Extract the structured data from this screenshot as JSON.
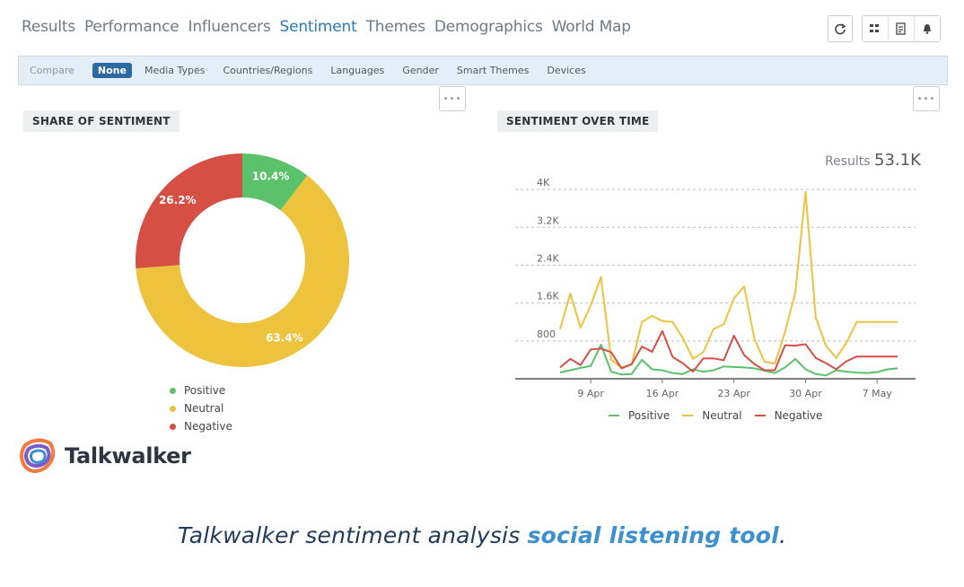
{
  "nav": {
    "tabs": [
      {
        "label": "Results",
        "active": false
      },
      {
        "label": "Performance",
        "active": false
      },
      {
        "label": "Influencers",
        "active": false
      },
      {
        "label": "Sentiment",
        "active": true
      },
      {
        "label": "Themes",
        "active": false
      },
      {
        "label": "Demographics",
        "active": false
      },
      {
        "label": "World Map",
        "active": false
      }
    ],
    "actions": [
      "refresh-icon",
      "grid-add-icon",
      "export-icon",
      "alert-icon"
    ]
  },
  "compare_bar": {
    "label": "Compare",
    "items": [
      {
        "label": "None",
        "active": true
      },
      {
        "label": "Media Types",
        "active": false
      },
      {
        "label": "Countries/Regions",
        "active": false
      },
      {
        "label": "Languages",
        "active": false
      },
      {
        "label": "Gender",
        "active": false
      },
      {
        "label": "Smart Themes",
        "active": false
      },
      {
        "label": "Devices",
        "active": false
      }
    ]
  },
  "colors": {
    "positive": "#5bc26b",
    "neutral": "#edc23d",
    "negative": "#d54f45",
    "accent": "#2b7ab4"
  },
  "panels": {
    "share": {
      "title": "SHARE OF SENTIMENT",
      "more_icon": "more-icon"
    },
    "over_time": {
      "title": "SENTIMENT OVER TIME",
      "more_icon": "more-icon",
      "results_label": "Results",
      "results_value": "53.1K"
    }
  },
  "chart_data": [
    {
      "type": "pie",
      "title": "SHARE OF SENTIMENT",
      "categories": [
        "Positive",
        "Neutral",
        "Negative"
      ],
      "values": [
        10.4,
        63.4,
        26.2
      ],
      "labels": [
        "10.4%",
        "63.4%",
        "26.2%"
      ],
      "style": "donut",
      "legend": "bottom"
    },
    {
      "type": "line",
      "title": "SENTIMENT OVER TIME",
      "ylim": [
        0,
        4400
      ],
      "yticks": [
        800,
        1600,
        2400,
        3200,
        4000
      ],
      "ytick_labels": [
        "800",
        "1.6K",
        "2.4K",
        "3.2K",
        "4K"
      ],
      "xticks": [
        3,
        10,
        17,
        24,
        31
      ],
      "xtick_labels": [
        "9 Apr",
        "16 Apr",
        "23 Apr",
        "30 Apr",
        "7 May"
      ],
      "x": [
        0,
        1,
        2,
        3,
        4,
        5,
        6,
        7,
        8,
        9,
        10,
        11,
        12,
        13,
        14,
        15,
        16,
        17,
        18,
        19,
        20,
        21,
        22,
        23,
        24,
        25,
        26,
        27,
        28,
        29,
        30,
        31,
        32,
        33
      ],
      "series": [
        {
          "name": "Positive",
          "values": [
            130,
            180,
            230,
            270,
            720,
            150,
            90,
            100,
            400,
            200,
            180,
            120,
            100,
            200,
            150,
            180,
            260,
            250,
            240,
            220,
            170,
            120,
            240,
            420,
            200,
            100,
            70,
            180,
            150,
            130,
            120,
            140,
            200,
            220
          ]
        },
        {
          "name": "Neutral",
          "values": [
            1050,
            1800,
            1080,
            1550,
            2150,
            400,
            240,
            300,
            1200,
            1330,
            1220,
            1200,
            860,
            420,
            560,
            1050,
            1150,
            1700,
            1950,
            840,
            360,
            320,
            990,
            1820,
            3950,
            1290,
            700,
            440,
            760,
            1200,
            1200,
            1200,
            1200,
            1200
          ]
        },
        {
          "name": "Negative",
          "values": [
            240,
            420,
            290,
            620,
            640,
            560,
            220,
            310,
            680,
            570,
            1010,
            460,
            330,
            150,
            430,
            430,
            390,
            910,
            500,
            310,
            180,
            180,
            710,
            700,
            730,
            440,
            330,
            200,
            370,
            470,
            470,
            470,
            470,
            470
          ]
        }
      ],
      "legend": "bottom",
      "grid": true
    }
  ],
  "logo": {
    "text": "Talkwalker"
  },
  "caption": {
    "prefix": "Talkwalker sentiment analysis ",
    "highlight": "social listening tool",
    "suffix": "."
  }
}
